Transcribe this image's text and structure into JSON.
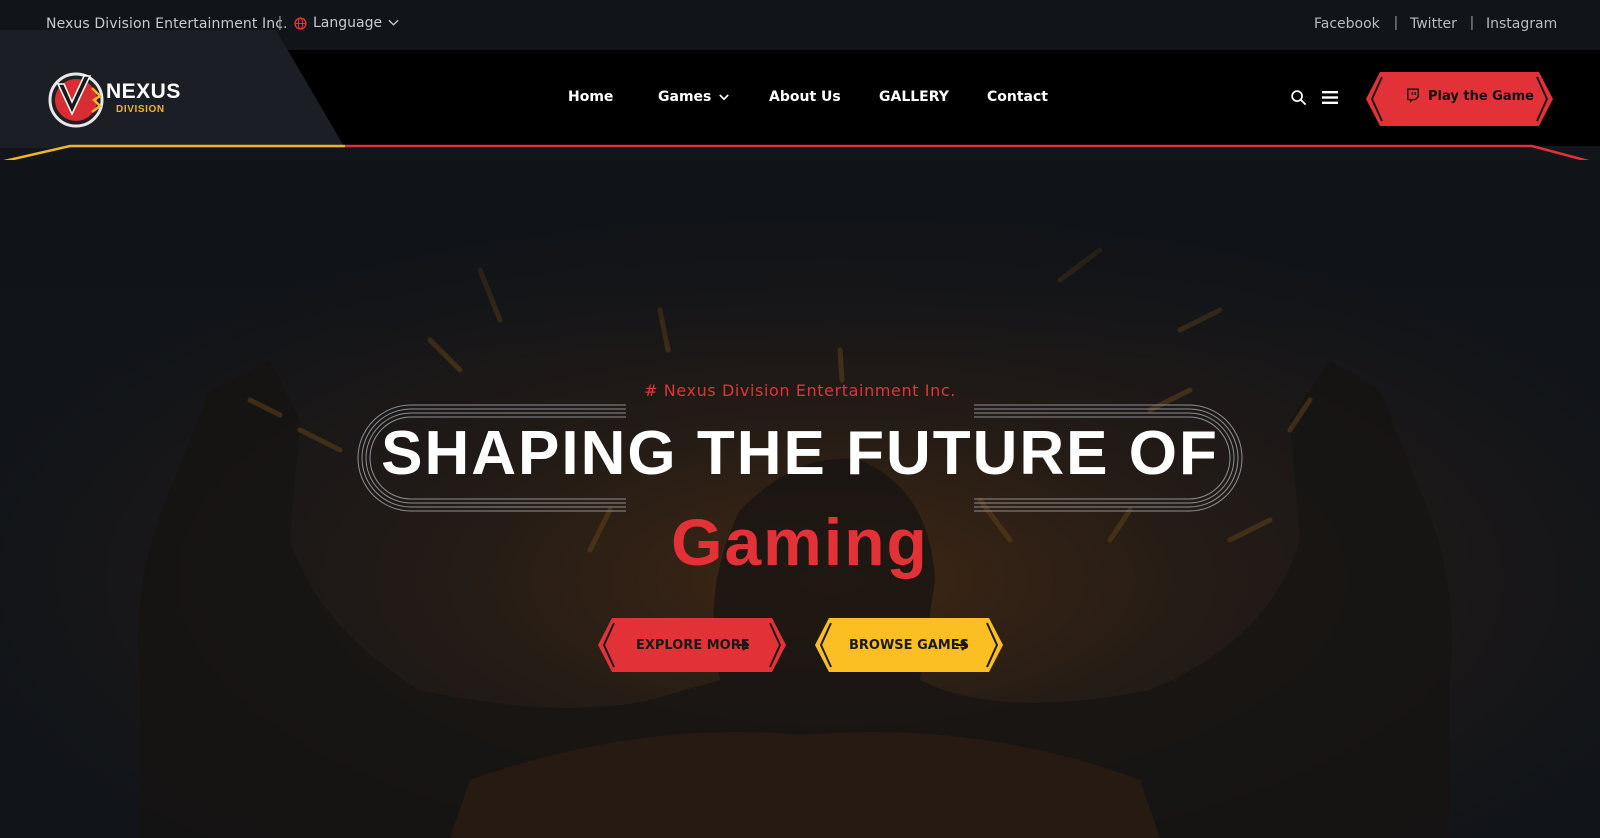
{
  "topbar": {
    "company": "Nexus Division Entertainment Inc.",
    "language_label": "Language",
    "social": [
      "Facebook",
      "Twitter",
      "Instagram"
    ]
  },
  "logo": {
    "line1": "NEXUS",
    "line2": "DIVISION"
  },
  "nav": {
    "links": [
      "Home",
      "Games",
      "About Us",
      "GALLERY",
      "Contact"
    ],
    "play_label": "Play the Game"
  },
  "hero": {
    "eyebrow": "# Nexus Division Entertainment Inc.",
    "headline": "SHAPING THE FUTURE OF",
    "headline_accent": "Gaming",
    "explore_label": "EXPLORE MORE",
    "browse_label": "BROWSE GAMES"
  },
  "colors": {
    "accent_red": "#e23237",
    "accent_yellow": "#fbbf24",
    "nav_bg": "#000000",
    "hero_bg": "#121519"
  },
  "icons": [
    "globe-icon",
    "chevron-down-icon",
    "search-icon",
    "menu-icon",
    "twitch-icon",
    "arrow-right-icon"
  ]
}
